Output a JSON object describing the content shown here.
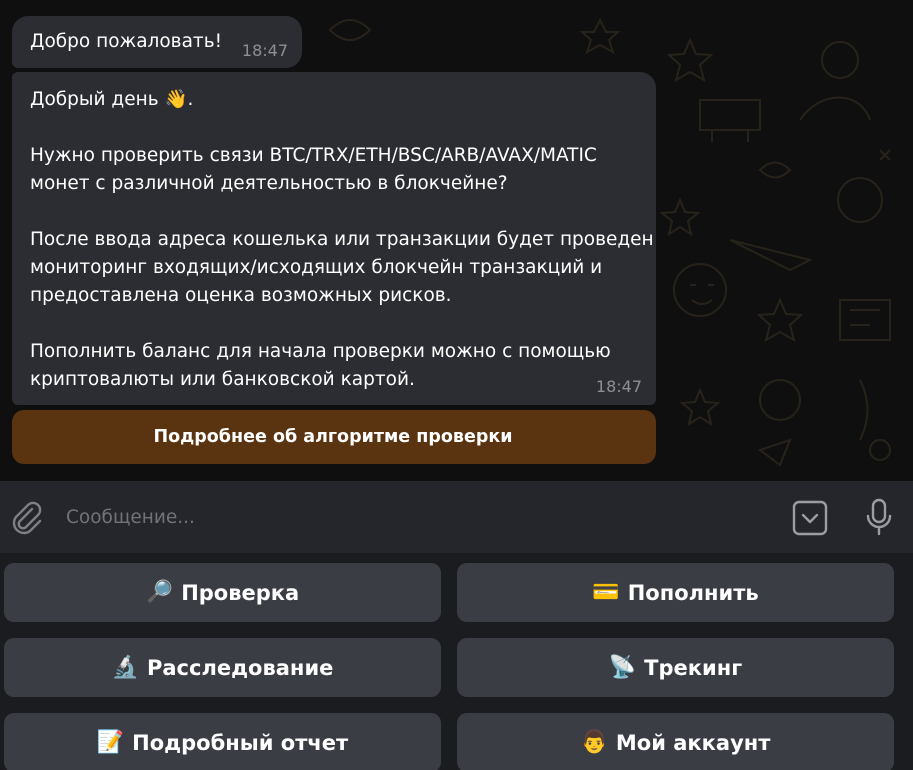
{
  "chat": {
    "welcome": {
      "text": "Добро пожаловать!",
      "time": "18:47"
    },
    "message": {
      "greeting": "Добрый день 👋.",
      "lines_p1": [
        "Нужно проверить связи BTC/TRX/ETH/BSC/ARB/AVAX/MATIC",
        "монет с различной деятельностью в блокчейне?"
      ],
      "lines_p2": [
        "После ввода адреса кошелька или транзакции будет проведен",
        "мониторинг входящих/исходящих блокчейн транзакций и",
        "предоставлена оценка возможных рисков."
      ],
      "lines_p3": [
        "Пополнить баланс для начала проверки можно с помощью",
        "криптовалюты или банковской картой."
      ],
      "time": "18:47"
    },
    "inline_button": "Подробнее об алгоритме проверки",
    "inline_button_color": "#5a3410"
  },
  "input": {
    "placeholder": "Сообщение...",
    "value": "",
    "icons": [
      "paperclip-icon",
      "keyboard-toggle-icon",
      "microphone-icon"
    ]
  },
  "keyboard": {
    "buttons": [
      {
        "emoji": "🔎",
        "label": "Проверка"
      },
      {
        "emoji": "💳",
        "label": "Пополнить"
      },
      {
        "emoji": "🔬",
        "label": "Расследование"
      },
      {
        "emoji": "📡",
        "label": "Трекинг"
      },
      {
        "emoji": "📝",
        "label": "Подробный отчет"
      },
      {
        "emoji": "👨",
        "label": "Мой аккаунт"
      }
    ]
  },
  "colors": {
    "bubble": "#2b2d33",
    "chat_bg": "#0f0f0f",
    "input_bar": "#24262b",
    "keyboard_bg": "#1b1c20",
    "keyboard_button": "#3a3d44",
    "time_text": "#8c8f96"
  }
}
